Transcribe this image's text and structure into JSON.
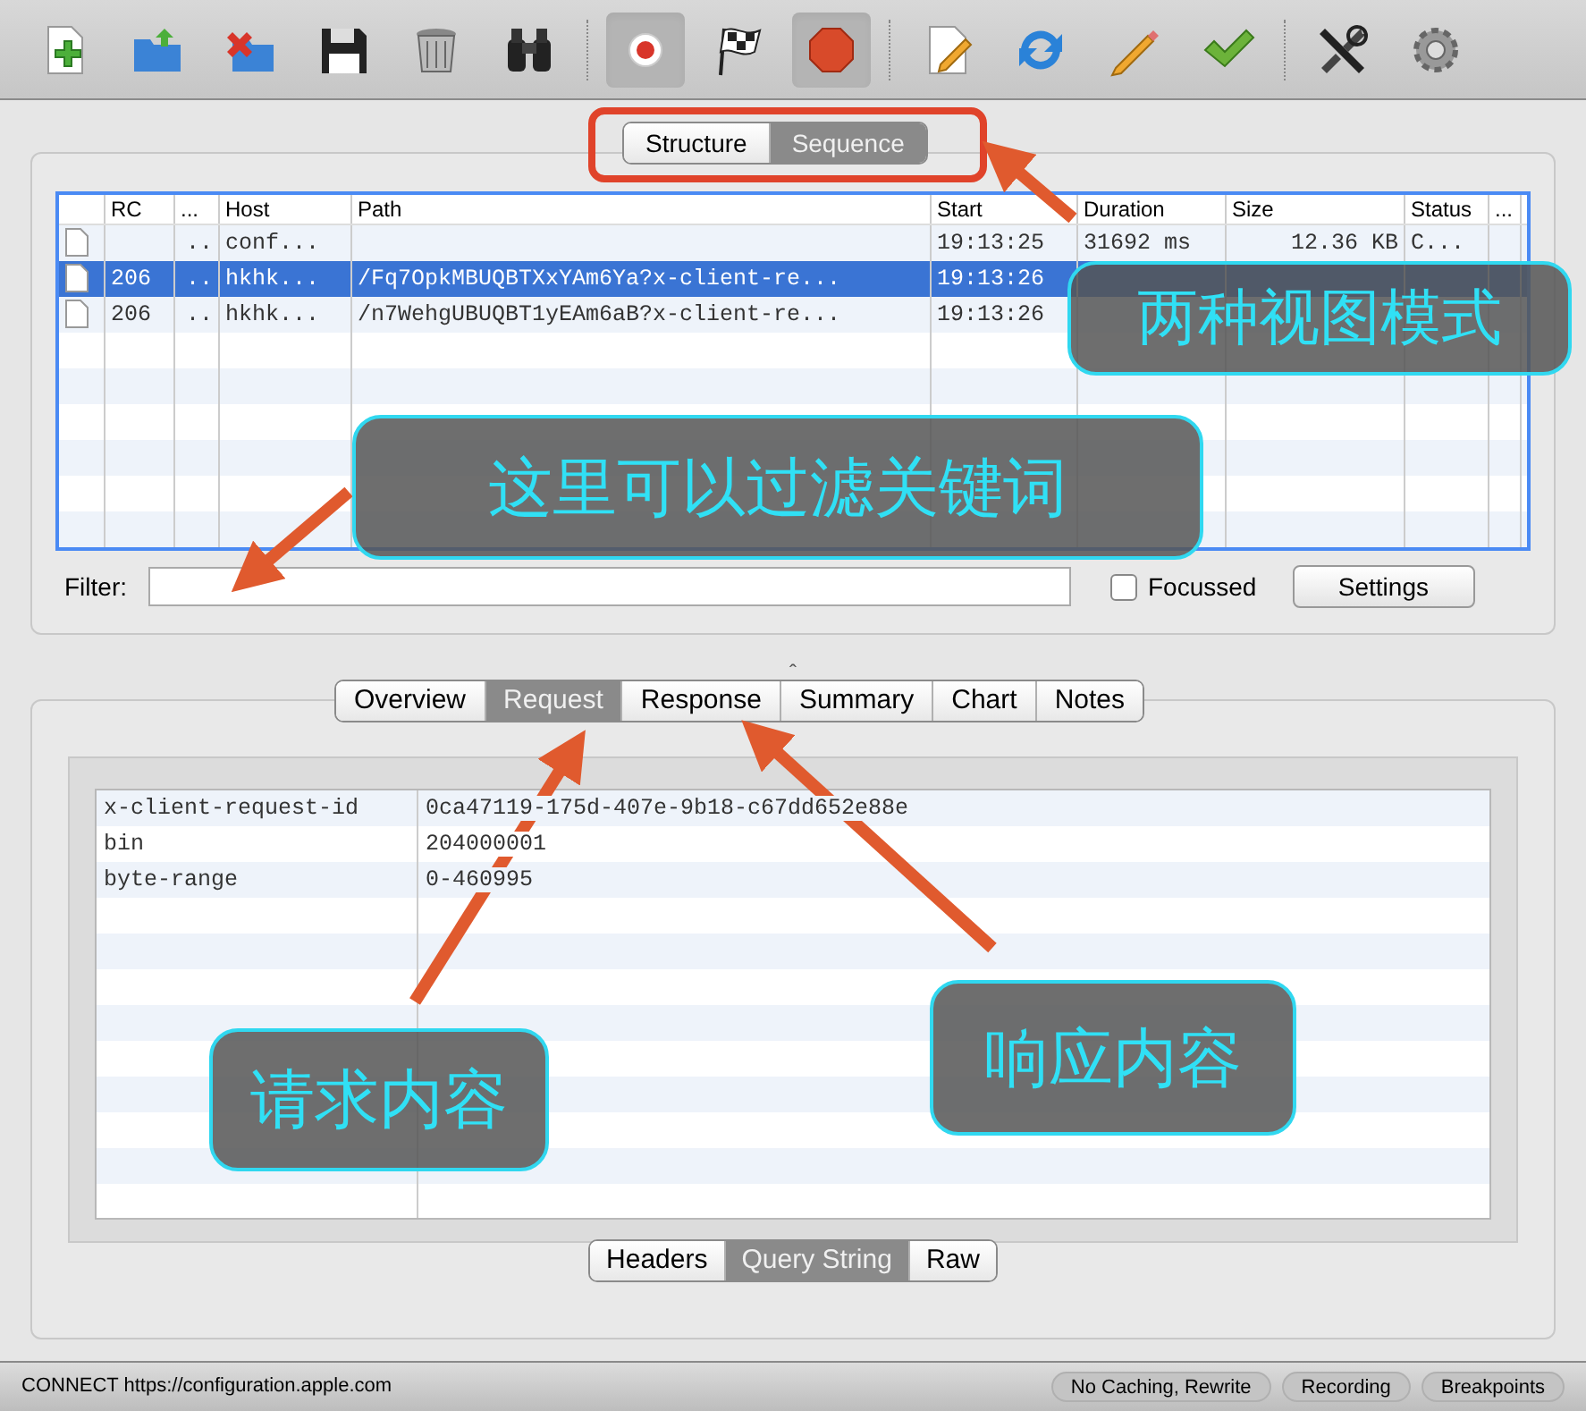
{
  "toolbar": [
    {
      "kind": "new",
      "pressed": false
    },
    {
      "kind": "open",
      "pressed": false
    },
    {
      "kind": "close",
      "pressed": false
    },
    {
      "kind": "save",
      "pressed": false
    },
    {
      "kind": "trash",
      "pressed": false
    },
    {
      "kind": "find",
      "pressed": false
    },
    {
      "kind": "separator"
    },
    {
      "kind": "record",
      "pressed": true
    },
    {
      "kind": "flag",
      "pressed": false
    },
    {
      "kind": "stop",
      "pressed": true
    },
    {
      "kind": "separator"
    },
    {
      "kind": "compose",
      "pressed": false
    },
    {
      "kind": "repeat",
      "pressed": false
    },
    {
      "kind": "edit",
      "pressed": false
    },
    {
      "kind": "validate",
      "pressed": false
    },
    {
      "kind": "separator"
    },
    {
      "kind": "tools",
      "pressed": false
    },
    {
      "kind": "settings",
      "pressed": false
    }
  ],
  "view_switch": [
    {
      "label": "Structure",
      "selected": false
    },
    {
      "label": "Sequence",
      "selected": true
    }
  ],
  "table": {
    "columns": [
      "RC",
      "...",
      "Host",
      "Path",
      "Start",
      "Duration",
      "Size",
      "Status",
      "..."
    ],
    "rows": [
      {
        "selected": false,
        "dots": "..",
        "host": "conf...",
        "start": "19:13:25",
        "duration": "31692 ms",
        "size": "12.36 KB",
        "status": "C..."
      },
      {
        "selected": true,
        "rc": "206",
        "dots": "..",
        "host": "hkhk...",
        "path": "/Fq7OpkMBUQBTXxYAm6Ya?x-client-re...",
        "start": "19:13:26"
      },
      {
        "selected": false,
        "rc": "206",
        "dots": "..",
        "host": "hkhk...",
        "path": "/n7WehgUBUQBT1yEAm6aB?x-client-re...",
        "start": "19:13:26"
      }
    ]
  },
  "filter": {
    "label": "Filter:",
    "focussed": {
      "label": "Focussed",
      "checked": false
    },
    "settings_button": "Settings"
  },
  "splitter": "ˆ",
  "detail_tabs": [
    {
      "label": "Overview",
      "selected": false
    },
    {
      "label": "Request",
      "selected": true
    },
    {
      "label": "Response",
      "selected": false
    },
    {
      "label": "Summary",
      "selected": false
    },
    {
      "label": "Chart",
      "selected": false
    },
    {
      "label": "Notes",
      "selected": false
    }
  ],
  "params": [
    {
      "name": "x-client-request-id",
      "value": "0ca47119-175d-407e-9b18-c67dd652e88e"
    },
    {
      "name": "bin",
      "value": "204000001"
    },
    {
      "name": "byte-range",
      "value": "0-460995"
    }
  ],
  "sub_tabs": [
    {
      "label": "Headers",
      "selected": false
    },
    {
      "label": "Query String",
      "selected": true
    },
    {
      "label": "Raw",
      "selected": false
    }
  ],
  "status_bar": {
    "text": "CONNECT https://configuration.apple.com",
    "badges": [
      "No Caching, Rewrite",
      "Recording",
      "Breakpoints"
    ]
  },
  "annotations": [
    {
      "text": "两种视图模式"
    },
    {
      "text": "这里可以过滤关键词"
    },
    {
      "text": "请求内容"
    },
    {
      "text": "响应内容"
    }
  ]
}
